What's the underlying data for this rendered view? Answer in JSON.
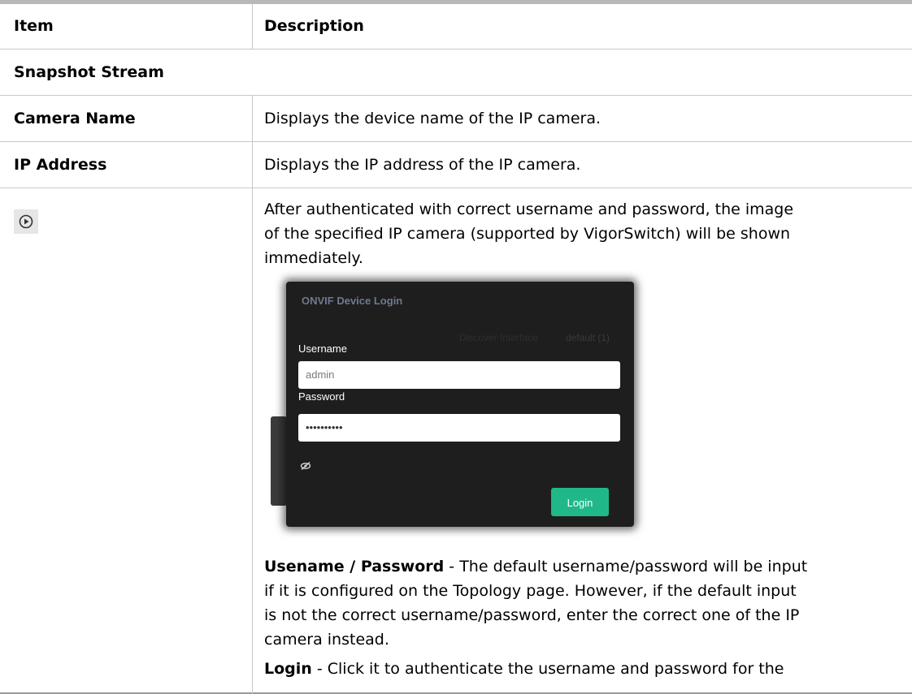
{
  "table": {
    "header": {
      "item": "Item",
      "description": "Description"
    },
    "section": "Snapshot Stream",
    "rows": [
      {
        "item": "Camera Name",
        "description": "Displays the device name of the IP camera."
      },
      {
        "item": "IP Address",
        "description": "Displays the IP address of the IP camera."
      }
    ],
    "play_row": {
      "icon": "play-circle-icon",
      "lines": [
        "After authenticated with correct username and password, the image",
        "of the specified IP camera (supported by VigorSwitch) will be shown",
        "immediately."
      ],
      "notes": [
        {
          "term": "Usename / Password",
          "lines": [
            " - The default username/password will be input",
            "if it is configured on the Topology page. However, if the default input",
            "is not the correct username/password, enter the correct one of the IP",
            "camera instead."
          ]
        },
        {
          "term": "Login",
          "lines": [
            " - Click it to authenticate the username and password for the"
          ]
        }
      ]
    }
  },
  "dialog": {
    "title": "ONVIF Device Login",
    "bg_label": "Discover Interface",
    "bg_value": "default (1)",
    "username_label": "Username",
    "username_value": "admin",
    "password_label": "Password",
    "password_value": "••••••••••",
    "eye_icon": "eye-slash-icon",
    "login_label": "Login",
    "colors": {
      "dialog_bg": "#1e1e1e",
      "login_button": "#20b889",
      "title": "#6d7a93"
    }
  }
}
